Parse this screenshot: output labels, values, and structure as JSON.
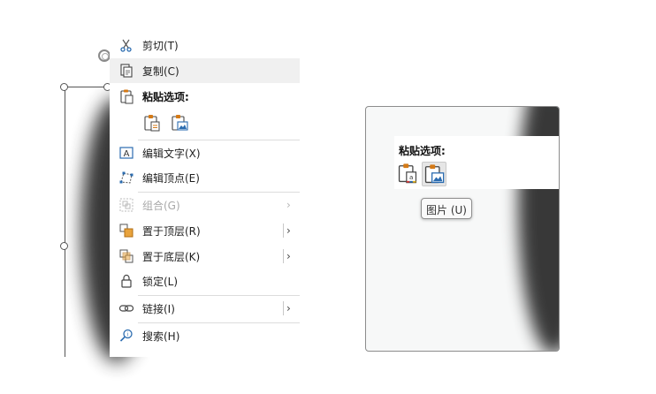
{
  "context_menu": {
    "cut_label": "剪切(T)",
    "copy_label": "复制(C)",
    "paste_options_label": "粘贴选项:",
    "edit_text_label": "编辑文字(X)",
    "edit_points_label": "编辑顶点(E)",
    "group_label": "组合(G)",
    "bring_to_front_label": "置于顶层(R)",
    "send_to_back_label": "置于底层(K)",
    "lock_label": "锁定(L)",
    "link_label": "链接(I)",
    "search_label": "搜索(H)"
  },
  "zoom_preview": {
    "paste_options_label": "粘贴选项:",
    "tooltip": "图片 (U)"
  },
  "colors": {
    "accent_orange": "#d47a17",
    "accent_blue": "#2b6cb0",
    "menu_hover": "#f0f0f0"
  },
  "icons": {
    "cut": "scissors-icon",
    "copy": "copy-icon",
    "paste": "clipboard-icon",
    "keep_text": "clipboard-text-icon",
    "picture": "clipboard-picture-icon",
    "edit_text": "text-box-icon",
    "edit_points": "edit-points-icon",
    "group": "group-icon",
    "bring_front": "bring-to-front-icon",
    "send_back": "send-to-back-icon",
    "lock": "lock-icon",
    "link": "link-icon",
    "search": "search-icon"
  }
}
